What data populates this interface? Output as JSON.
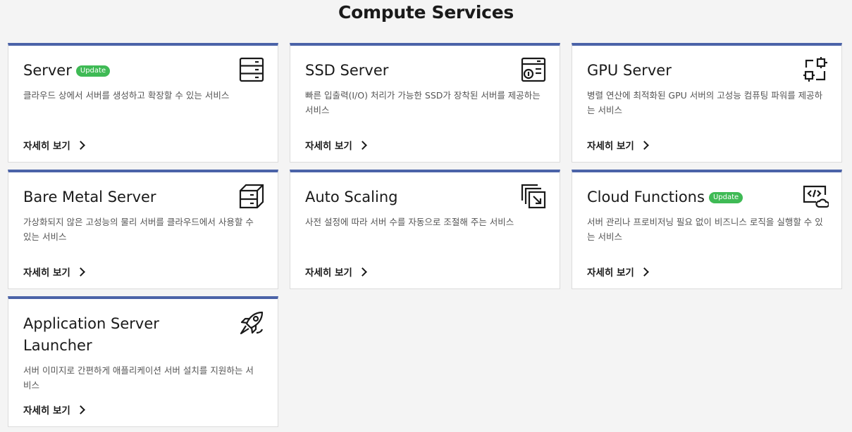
{
  "header": {
    "title": "Compute Services"
  },
  "cards": [
    {
      "title": "Server",
      "badge": "Update",
      "description": "클라우드 상에서 서버를 생성하고 확장할 수 있는 서비스",
      "link": "자세히 보기",
      "icon": "server-rack-icon"
    },
    {
      "title": "SSD Server",
      "badge": "",
      "description": "빠른 입출력(I/O) 처리가 가능한 SSD가 장착된 서버를 제공하는 서비스",
      "link": "자세히 보기",
      "icon": "ssd-server-icon"
    },
    {
      "title": "GPU Server",
      "badge": "",
      "description": "병렬 연산에 최적화된 GPU 서버의 고성능 컴퓨팅 파워를 제공하는 서비스",
      "link": "자세히 보기",
      "icon": "gpu-chip-icon"
    },
    {
      "title": "Bare Metal Server",
      "badge": "",
      "description": "가상화되지 않은 고성능의 물리 서버를 클라우드에서 사용할 수 있는 서비스",
      "link": "자세히 보기",
      "icon": "bare-metal-server-icon"
    },
    {
      "title": "Auto Scaling",
      "badge": "",
      "description": "사전 설정에 따라 서버 수를 자동으로 조절해 주는 서비스",
      "link": "자세히 보기",
      "icon": "auto-scaling-icon"
    },
    {
      "title": "Cloud Functions",
      "badge": "Update",
      "description": "서버 관리나 프로비저닝 필요 없이 비즈니스 로직을 실행할 수 있는 서비스",
      "link": "자세히 보기",
      "icon": "cloud-functions-icon"
    },
    {
      "title": "Application Server Launcher",
      "badge": "",
      "description": "서버 이미지로 간편하게 애플리케이션 서버 설치를 지원하는 서비스",
      "link": "자세히 보기",
      "icon": "rocket-icon"
    }
  ]
}
